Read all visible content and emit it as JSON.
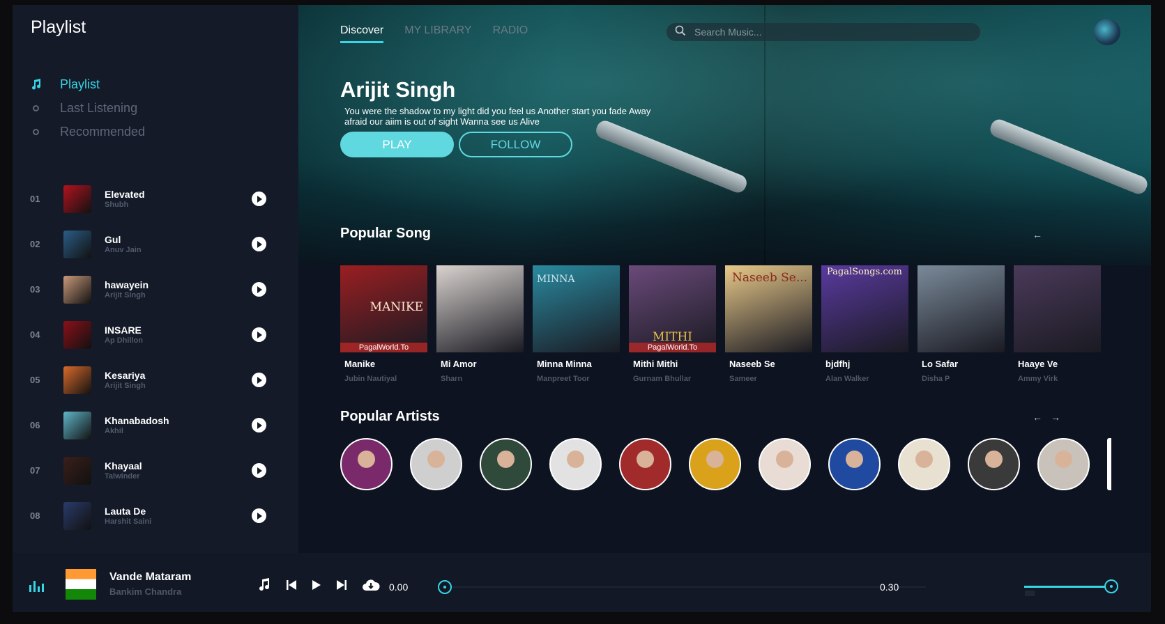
{
  "sidebar": {
    "title": "Playlist",
    "nav": [
      {
        "label": "Playlist",
        "icon": "music-note-icon",
        "active": true
      },
      {
        "label": "Last Listening",
        "icon": "circle-icon",
        "active": false
      },
      {
        "label": "Recommended",
        "icon": "circle-icon",
        "active": false
      }
    ],
    "tracks": [
      {
        "num": "01",
        "title": "Elevated",
        "artist": "Shubh",
        "color": "#b3121f"
      },
      {
        "num": "02",
        "title": "Gul",
        "artist": "Anuv Jain",
        "color": "#2b5d86"
      },
      {
        "num": "03",
        "title": "hawayein",
        "artist": "Arijit Singh",
        "color": "#c99a7a"
      },
      {
        "num": "04",
        "title": "INSARE",
        "artist": "Ap Dhillon",
        "color": "#8b1018"
      },
      {
        "num": "05",
        "title": "Kesariya",
        "artist": "Arijit Singh",
        "color": "#d96a2a"
      },
      {
        "num": "06",
        "title": "Khanabadosh",
        "artist": "Akhil",
        "color": "#5fb6c9"
      },
      {
        "num": "07",
        "title": "Khayaal",
        "artist": "Talwinder",
        "color": "#3a1f1a"
      },
      {
        "num": "08",
        "title": "Lauta De",
        "artist": "Harshit Saini",
        "color": "#2a3b6a"
      }
    ]
  },
  "header": {
    "tabs": [
      {
        "label": "Discover",
        "active": true
      },
      {
        "label": "MY LIBRARY",
        "active": false
      },
      {
        "label": "RADIO",
        "active": false
      }
    ],
    "search_placeholder": "Search Music..."
  },
  "hero": {
    "artist": "Arijit Singh",
    "description": "You were the shadow to my light did you feel us Another start you fade Away afraid our aiim is out of sight Wanna see us Alive",
    "play_label": "PLAY",
    "follow_label": "FOLLOW"
  },
  "popular_songs": {
    "title": "Popular Song",
    "arrow_left": "←",
    "items": [
      {
        "title": "Manike",
        "artist": "Jubin Nautiyal",
        "color": "#9a1f22",
        "caption": "MANIKE",
        "tag": "PagalWorld.To"
      },
      {
        "title": "Mi Amor",
        "artist": "Sharn",
        "color": "#d9d3cf",
        "caption": "",
        "tag": ""
      },
      {
        "title": "Minna Minna",
        "artist": "Manpreet Toor",
        "color": "#2a8aa0",
        "caption": "MINNA",
        "tag": ""
      },
      {
        "title": "Mithi Mithi",
        "artist": "Gurnam Bhullar",
        "color": "#6a4a7a",
        "caption": "MITHI",
        "tag": "PagalWorld.To"
      },
      {
        "title": "Naseeb Se",
        "artist": "Sameer",
        "color": "#e8c98a",
        "caption": "Naseeb Se...",
        "tag": ""
      },
      {
        "title": "bjdfhj",
        "artist": "Alan Walker",
        "color": "#5a3aa0",
        "caption": "PagalSongs.com",
        "tag": ""
      },
      {
        "title": "Lo Safar",
        "artist": "Disha P",
        "color": "#7a8a9a",
        "caption": "",
        "tag": ""
      },
      {
        "title": "Haaye Ve",
        "artist": "Ammy Virk",
        "color": "#4a3a5a",
        "caption": "",
        "tag": ""
      }
    ]
  },
  "popular_artists": {
    "title": "Popular Artists",
    "arrow_left": "←",
    "arrow_right": "→",
    "colors": [
      "#7a2a6a",
      "#cfcfcf",
      "#2f4a3a",
      "#e2e2e2",
      "#a12a2a",
      "#d9a21a",
      "#e8dcd4",
      "#1f4aa0",
      "#e8e0d0",
      "#3a3a3a",
      "#c8c2ba"
    ]
  },
  "player": {
    "title": "Vande Mataram",
    "artist": "Bankim Chandra",
    "current_time": "0.00",
    "duration": "0.30",
    "progress": 0,
    "volume": 1.0
  }
}
